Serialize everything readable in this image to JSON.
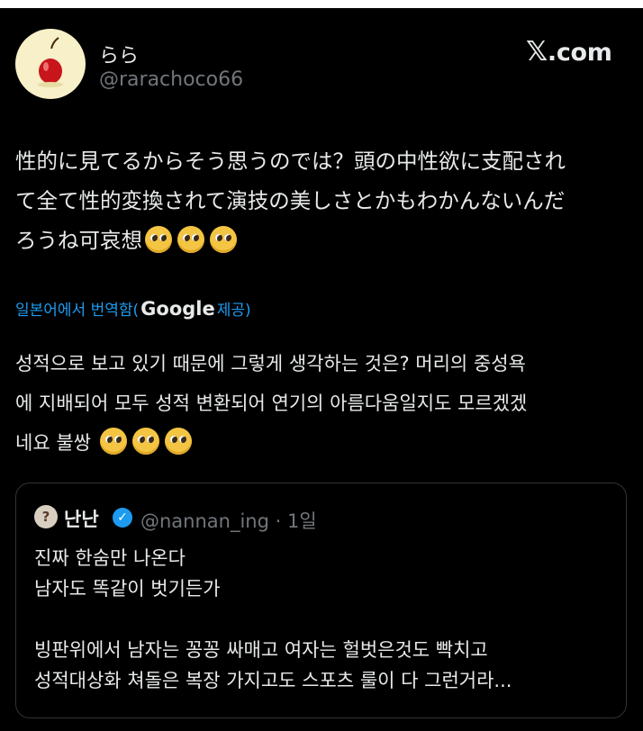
{
  "user": {
    "display_name": "らら",
    "handle": "@rarachoco66"
  },
  "brand": {
    "logo_x": "𝕏",
    "logo_domain": ".com"
  },
  "post": {
    "line1": "性的に見てるからそう思うのでは？頭の中性欲に支配され",
    "line2": "て全て性的変換されて演技の美しさとかもわかんないんだ",
    "line3": "ろうね可哀想"
  },
  "translation_note": {
    "prefix": "일본어에서 번역함(",
    "provider": "Google",
    "suffix": " 제공)"
  },
  "translated": {
    "line1": "성적으로 보고 있기 때문에 그렇게 생각하는 것은? 머리의 중성욕",
    "line2": "에 지배되어 모두 성적 변환되어 연기의 아름다움일지도 모르겠겠",
    "line3": "네요 불쌍"
  },
  "quoted": {
    "avatar_glyph": "?",
    "display_name": "난난",
    "verified_glyph": "✓",
    "handle_time": "@nannan_ing · 1일",
    "text": "진짜 한숨만 나온다\n남자도 똑같이 벗기든가\n\n빙판위에서 남자는 꽁꽁 싸매고 여자는 헐벗은것도 빡치고\n성적대상화 쳐돌은 복장 가지고도 스포츠 룰이 다 그런거라..."
  },
  "icons": {
    "avatar": "apple-candy-avatar",
    "emoji": "pleading-face-emoji",
    "verified": "verified-badge-icon"
  },
  "colors": {
    "background": "#000000",
    "text": "#e7e9ea",
    "secondary": "#71767b",
    "link": "#1d9bf0",
    "border": "#2f3336"
  }
}
